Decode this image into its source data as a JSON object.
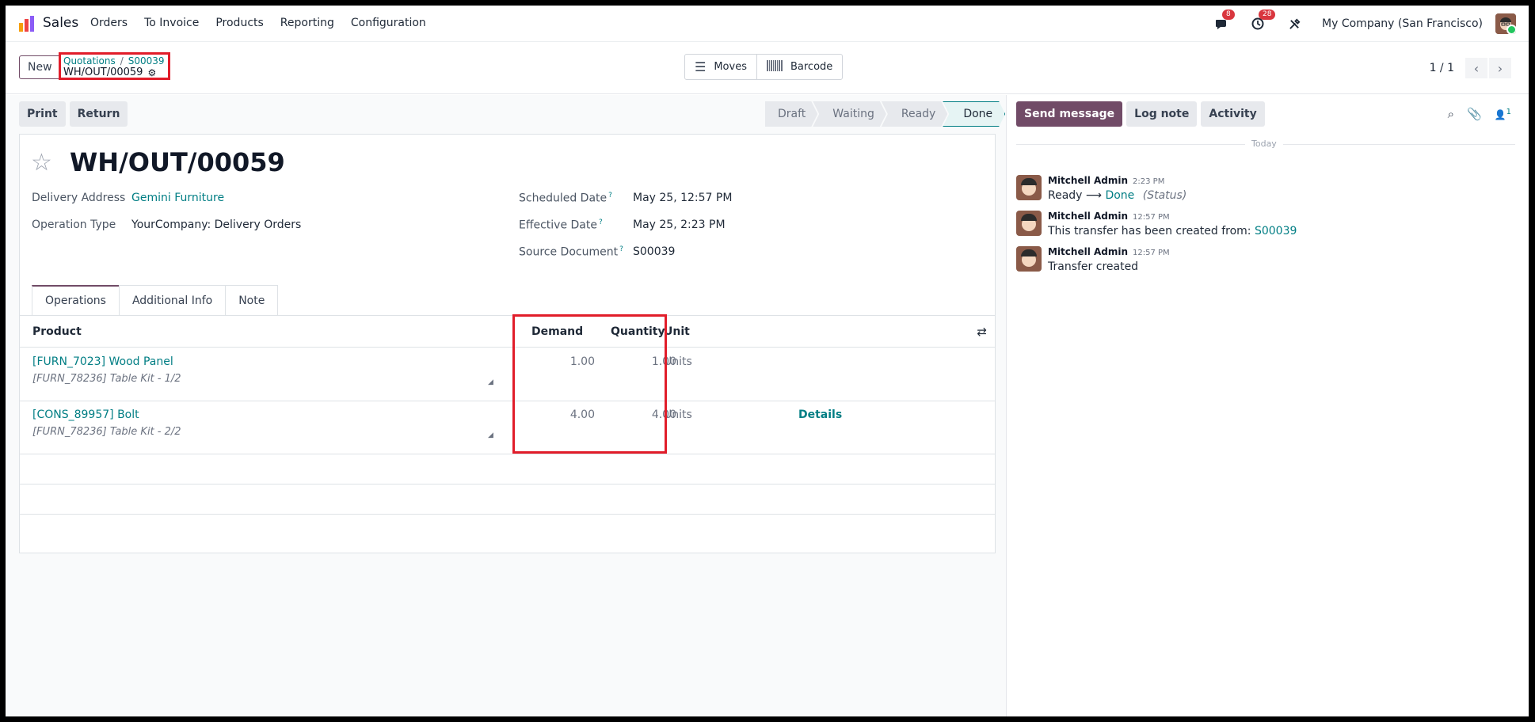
{
  "app": {
    "name": "Sales",
    "menu": [
      "Orders",
      "To Invoice",
      "Products",
      "Reporting",
      "Configuration"
    ],
    "messages_badge": "8",
    "activities_badge": "28",
    "company": "My Company (San Francisco)"
  },
  "control": {
    "new_label": "New",
    "breadcrumb": [
      "Quotations",
      "S00039"
    ],
    "current_record": "WH/OUT/00059",
    "smart_buttons": [
      {
        "label": "Moves",
        "icon": "list-icon"
      },
      {
        "label": "Barcode",
        "icon": "barcode-icon"
      }
    ],
    "pager": "1 / 1"
  },
  "form": {
    "actions": [
      "Print",
      "Return"
    ],
    "stages": [
      "Draft",
      "Waiting",
      "Ready",
      "Done"
    ],
    "active_stage": "Done",
    "title": "WH/OUT/00059",
    "fields": {
      "delivery_address_label": "Delivery Address",
      "delivery_address": "Gemini Furniture",
      "operation_type_label": "Operation Type",
      "operation_type": "YourCompany: Delivery Orders",
      "scheduled_date_label": "Scheduled Date",
      "scheduled_date": "May 25, 12:57 PM",
      "effective_date_label": "Effective Date",
      "effective_date": "May 25, 2:23 PM",
      "source_document_label": "Source Document",
      "source_document": "S00039",
      "help_mark": "?"
    },
    "tabs": [
      "Operations",
      "Additional Info",
      "Note"
    ],
    "table": {
      "headers": {
        "product": "Product",
        "demand": "Demand",
        "quantity": "Quantity",
        "unit": "Unit"
      },
      "rows": [
        {
          "product": "[FURN_7023] Wood Panel",
          "description": "[FURN_78236] Table Kit - 1/2",
          "demand": "1.00",
          "quantity": "1.00",
          "unit": "Units",
          "details": ""
        },
        {
          "product": "[CONS_89957] Bolt",
          "description": "[FURN_78236] Table Kit - 2/2",
          "demand": "4.00",
          "quantity": "4.00",
          "unit": "Units",
          "details": "Details"
        }
      ]
    }
  },
  "chatter": {
    "buttons": [
      "Send message",
      "Log note",
      "Activity"
    ],
    "followers_count": "1",
    "date_separator": "Today",
    "messages": [
      {
        "author": "Mitchell Admin",
        "time": "2:23 PM",
        "from": "Ready",
        "to": "Done",
        "field": "(Status)"
      },
      {
        "author": "Mitchell Admin",
        "time": "12:57 PM",
        "text": "This transfer has been created from:",
        "link": "S00039"
      },
      {
        "author": "Mitchell Admin",
        "time": "12:57 PM",
        "text": "Transfer created"
      }
    ]
  },
  "colors": {
    "brand": "#714b67",
    "link": "#017e84",
    "highlight": "#e11d2a"
  }
}
